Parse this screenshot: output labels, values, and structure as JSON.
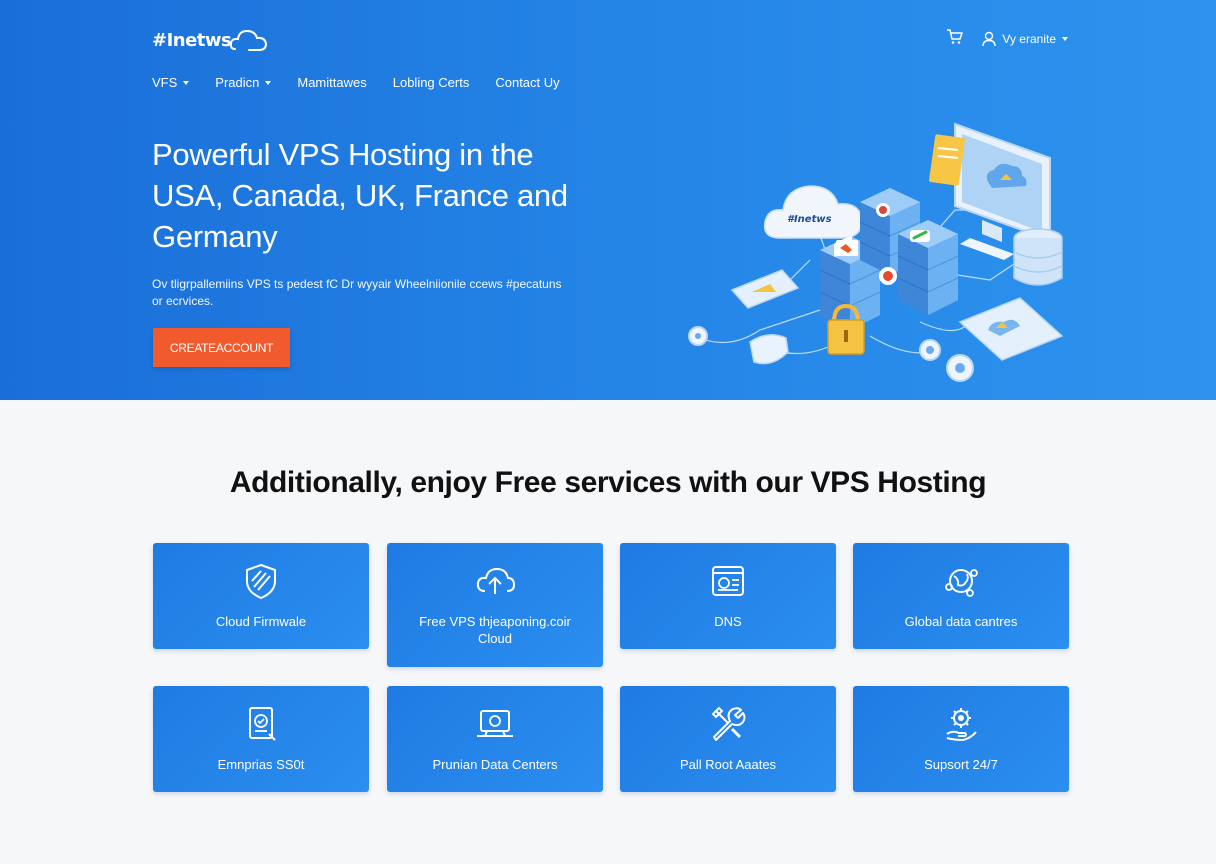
{
  "header": {
    "logo_text": "#Inetws",
    "nav": [
      {
        "label": "VFS",
        "has_dropdown": true
      },
      {
        "label": "Pradicn",
        "has_dropdown": true
      },
      {
        "label": "Mamittawes",
        "has_dropdown": false
      },
      {
        "label": "Lobling Certs",
        "has_dropdown": false
      },
      {
        "label": "Contact Uy",
        "has_dropdown": false
      }
    ],
    "account_label": "Vy eranite",
    "cart_icon": "cart-icon",
    "user_icon": "user-icon"
  },
  "hero": {
    "title": "Powerful VPS Hosting in the USA, Canada, UK, France and Germany",
    "subtitle": "Ov tligrpallemiins VPS ts pedest fC Dr wyyair Wheelniionile ccews #pecatuns or ecrvices.",
    "cta_label": "CREATEACCOUNT",
    "illustration_cloud_label": "#Inetws",
    "colors": {
      "hero_bg": "#1a6ed8",
      "cta_bg": "#f15a2d"
    }
  },
  "features": {
    "title": "Additionally, enjoy Free services with our VPS Hosting",
    "cards": [
      {
        "label": "Cloud Firmwale",
        "icon": "shield-icon"
      },
      {
        "label": "Free VPS thjeaponing.coir Cloud",
        "icon": "cloud-upload-icon"
      },
      {
        "label": "DNS",
        "icon": "dns-window-icon"
      },
      {
        "label": "Global data cantres",
        "icon": "globe-network-icon"
      },
      {
        "label": "Emnprias SS0t",
        "icon": "document-ssl-icon"
      },
      {
        "label": "Prunian Data Centers",
        "icon": "monitor-server-icon"
      },
      {
        "label": "Pall Root Aaates",
        "icon": "tools-icon"
      },
      {
        "label": "Supsort 24/7",
        "icon": "support-gear-icon"
      }
    ]
  }
}
